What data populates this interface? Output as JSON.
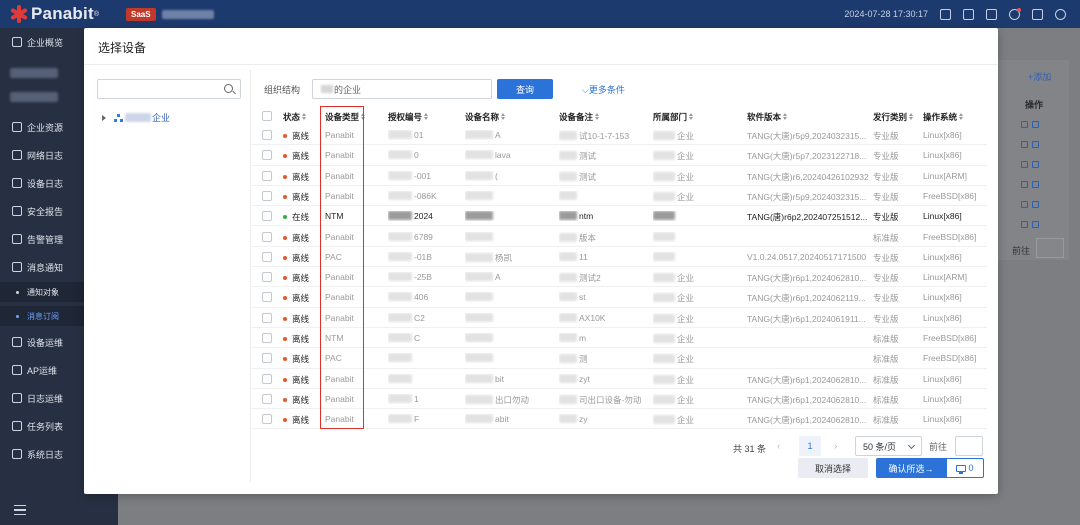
{
  "header": {
    "logo_text": "Panabit",
    "logo_sup": "®",
    "saas_badge": "SaaS",
    "datetime": "2024-07-28 17:30:17"
  },
  "sidebar": {
    "items": [
      {
        "label": "企业概览",
        "icon": "dashboard-icon"
      },
      {
        "label": "企业资源",
        "icon": "resource-icon"
      },
      {
        "label": "网络日志",
        "icon": "log-icon"
      },
      {
        "label": "设备日志",
        "icon": "device-log-icon"
      },
      {
        "label": "安全报告",
        "icon": "report-icon"
      },
      {
        "label": "告警管理",
        "icon": "bell-icon"
      },
      {
        "label": "消息通知",
        "icon": "message-icon"
      },
      {
        "label": "设备运维",
        "icon": "device-ops-icon"
      },
      {
        "label": "AP运维",
        "icon": "ap-icon"
      },
      {
        "label": "日志运维",
        "icon": "log-ops-icon"
      },
      {
        "label": "任务列表",
        "icon": "task-icon"
      },
      {
        "label": "系统日志",
        "icon": "gear-icon"
      }
    ],
    "sub_items": [
      {
        "label": "通知对象",
        "active": false
      },
      {
        "label": "消息订阅",
        "active": true
      }
    ]
  },
  "background": {
    "add_label": "+添加",
    "op_label": "操作",
    "goto_label": "前往"
  },
  "modal": {
    "title": "选择设备",
    "org_label": "组织结构",
    "org_value_suffix": "的企业",
    "query_button": "查询",
    "more_conditions": "更多条件",
    "tree_node_suffix": "企业",
    "columns": [
      "状态",
      "设备类型",
      "授权编号",
      "设备名称",
      "设备备注",
      "所属部门",
      "软件版本",
      "发行类别",
      "操作系统"
    ],
    "rows": [
      {
        "status": "离线",
        "online": false,
        "type": "Panabit",
        "auth": "01",
        "name": "A",
        "remark": "试10-1-7-153",
        "dept": "企业",
        "version": "TANG(大唐)r5p9,2024032315...",
        "edition": "专业版",
        "os": "Linux[x86]"
      },
      {
        "status": "离线",
        "online": false,
        "type": "Panabit",
        "auth": "0",
        "name": "lava",
        "remark": "测试",
        "dept": "企业",
        "version": "TANG(大唐)r5p7,2023122718...",
        "edition": "专业版",
        "os": "Linux[x86]"
      },
      {
        "status": "离线",
        "online": false,
        "type": "Panabit",
        "auth": "-001",
        "name": "(",
        "remark": "测试",
        "dept": "企业",
        "version": "TANG(大唐)r6,20240426102932",
        "edition": "专业版",
        "os": "Linux[ARM]"
      },
      {
        "status": "离线",
        "online": false,
        "type": "Panabit",
        "auth": "-086K",
        "name": "",
        "remark": "",
        "dept": "企业",
        "version": "TANG(大唐)r5p9,2024032315...",
        "edition": "专业版",
        "os": "FreeBSD[x86]"
      },
      {
        "status": "在线",
        "online": true,
        "type": "NTM",
        "auth": "2024",
        "name": "",
        "remark": "ntm",
        "dept": "",
        "version": "TANG(唐)r6p2,202407251512...",
        "edition": "专业版",
        "os": "Linux[x86]"
      },
      {
        "status": "离线",
        "online": false,
        "type": "Panabit",
        "auth": "6789",
        "name": "",
        "remark": "版本",
        "dept": "",
        "version": "",
        "edition": "标准版",
        "os": "FreeBSD[x86]"
      },
      {
        "status": "离线",
        "online": false,
        "type": "PAC",
        "auth": "-01B",
        "name": "杨凯",
        "remark": "11",
        "dept": "",
        "version": "V1.0.24.0517,20240517171500",
        "edition": "专业版",
        "os": "Linux[x86]"
      },
      {
        "status": "离线",
        "online": false,
        "type": "Panabit",
        "auth": "-25B",
        "name": "A",
        "remark": "测试2",
        "dept": "企业",
        "version": "TANG(大唐)r6p1,2024062810...",
        "edition": "专业版",
        "os": "Linux[ARM]"
      },
      {
        "status": "离线",
        "online": false,
        "type": "Panabit",
        "auth": "406",
        "name": "",
        "remark": "st",
        "dept": "企业",
        "version": "TANG(大唐)r6p1,2024062119...",
        "edition": "专业版",
        "os": "Linux[x86]"
      },
      {
        "status": "离线",
        "online": false,
        "type": "Panabit",
        "auth": "C2",
        "name": "",
        "remark": "AX10K",
        "dept": "企业",
        "version": "TANG(大唐)r6p1,2024061911...",
        "edition": "专业版",
        "os": "Linux[x86]"
      },
      {
        "status": "离线",
        "online": false,
        "type": "NTM",
        "auth": "C",
        "name": "",
        "remark": "m",
        "dept": "企业",
        "version": "",
        "edition": "标准版",
        "os": "FreeBSD[x86]"
      },
      {
        "status": "离线",
        "online": false,
        "type": "PAC",
        "auth": "",
        "name": "",
        "remark": "测",
        "dept": "企业",
        "version": "",
        "edition": "标准版",
        "os": "FreeBSD[x86]"
      },
      {
        "status": "离线",
        "online": false,
        "type": "Panabit",
        "auth": "",
        "name": "bit",
        "remark": "zyt",
        "dept": "企业",
        "version": "TANG(大唐)r6p1,2024062810...",
        "edition": "标准版",
        "os": "Linux[x86]"
      },
      {
        "status": "离线",
        "online": false,
        "type": "Panabit",
        "auth": "1",
        "name": "出口勿动",
        "remark": "司出口设备-勿动",
        "dept": "企业",
        "version": "TANG(大唐)r6p1,2024062810...",
        "edition": "标准版",
        "os": "Linux[x86]"
      },
      {
        "status": "离线",
        "online": false,
        "type": "Panabit",
        "auth": "F",
        "name": "abit",
        "remark": "zy",
        "dept": "企业",
        "version": "TANG(大唐)r6p1,2024062810...",
        "edition": "标准版",
        "os": "Linux[x86]"
      }
    ],
    "pagination": {
      "total": "共 31 条",
      "current_page": "1",
      "page_size": "50 条/页",
      "goto_label": "前往"
    },
    "cancel_button": "取消选择",
    "confirm_button": "确认所选→",
    "selected_count": "0"
  },
  "colors": {
    "primary": "#2b73d8",
    "offline": "#e8562a",
    "online": "#2fb344",
    "highlight": "#e0302a"
  }
}
